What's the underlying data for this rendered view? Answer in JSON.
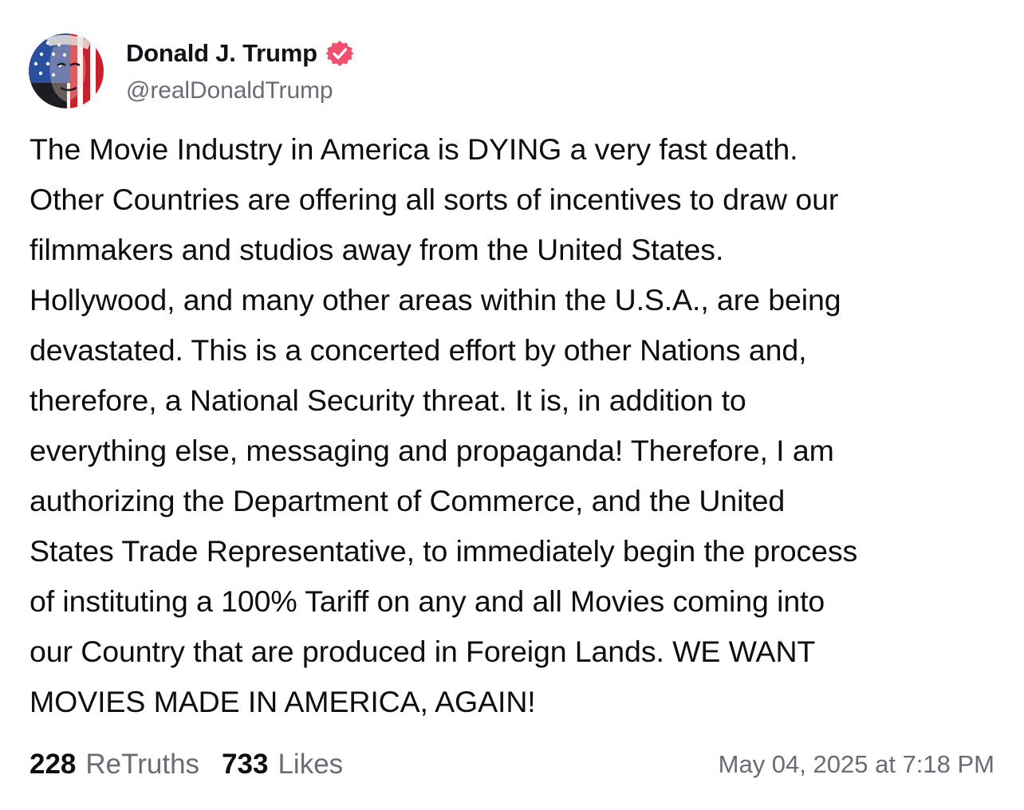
{
  "author": {
    "display_name": "Donald J. Trump",
    "handle": "@realDonaldTrump",
    "verified": true,
    "avatar_icon": "profile-photo-flag-overlay",
    "verified_color": "#f0506e"
  },
  "post": {
    "text": "The Movie Industry in America is DYING a very fast death.\nOther Countries are offering all sorts of incentives to draw our\nfilmmakers and studios away from the United States.\nHollywood, and many other areas within the U.S.A., are being\ndevastated. This is a concerted effort by other Nations and,\ntherefore, a National Security threat. It is, in addition to\neverything else, messaging and propaganda! Therefore, I am\nauthorizing the Department of Commerce, and the United\nStates Trade Representative, to immediately begin the process\nof instituting a 100% Tariff on any and all Movies coming into\nour Country that are produced in Foreign Lands. WE WANT\nMOVIES MADE IN AMERICA, AGAIN!"
  },
  "stats": {
    "retruths_count": "228",
    "retruths_label": "ReTruths",
    "likes_count": "733",
    "likes_label": "Likes"
  },
  "timestamp": "May 04, 2025 at 7:18 PM"
}
